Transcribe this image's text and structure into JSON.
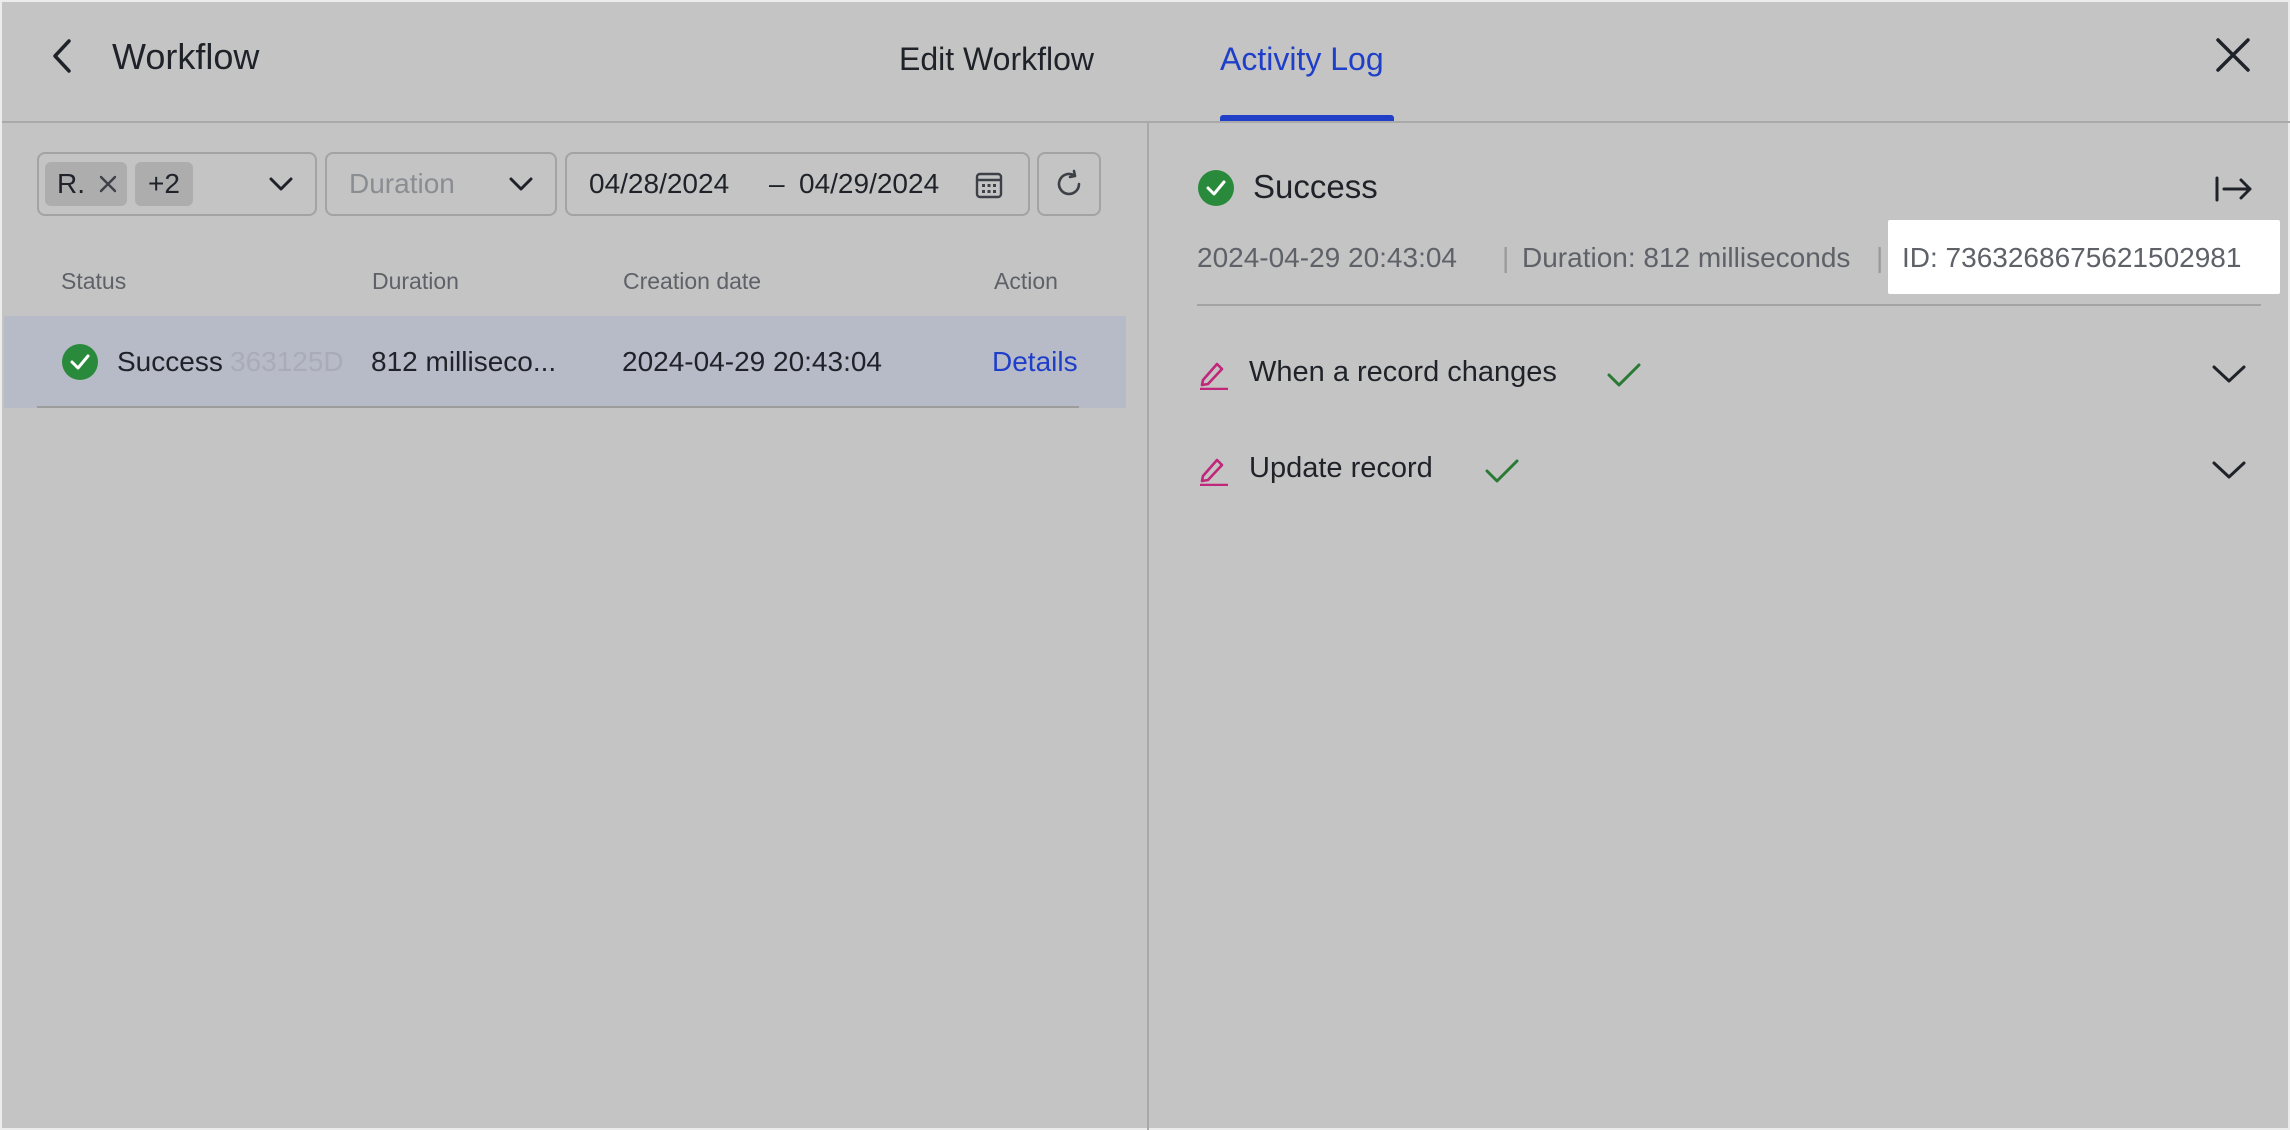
{
  "header": {
    "title": "Workflow",
    "tabs": [
      {
        "label": "Edit Workflow",
        "active": false
      },
      {
        "label": "Activity Log",
        "active": true
      }
    ]
  },
  "filters": {
    "user_chip": "R.",
    "more_chip": "+2",
    "duration_placeholder": "Duration",
    "date_from": "04/28/2024",
    "date_separator": "–",
    "date_to": "04/29/2024"
  },
  "table": {
    "headers": [
      "Status",
      "Duration",
      "Creation date",
      "Action"
    ],
    "rows": [
      {
        "status": "Success",
        "ghost_text": "363125D",
        "duration": "812 milliseco...",
        "created": "2024-04-29 20:43:04",
        "action": "Details"
      }
    ]
  },
  "detail": {
    "status": "Success",
    "timestamp": "2024-04-29 20:43:04",
    "separator": "|",
    "duration": "Duration: 812 milliseconds",
    "id": "ID: 7363268675621502981",
    "steps": [
      {
        "label": "When a record changes"
      },
      {
        "label": "Update record"
      }
    ]
  },
  "colors": {
    "accent": "#1f3fc9",
    "success": "#2a8a3c",
    "step_icon": "#c0267a",
    "overlay_bg": "#c4c4c4"
  },
  "icons": {
    "back": "chevron-left-icon",
    "close": "close-icon",
    "calendar": "calendar-icon",
    "refresh": "refresh-icon",
    "collapse": "collapse-panel-icon",
    "step": "pen-icon",
    "expand": "chevron-down-icon"
  }
}
